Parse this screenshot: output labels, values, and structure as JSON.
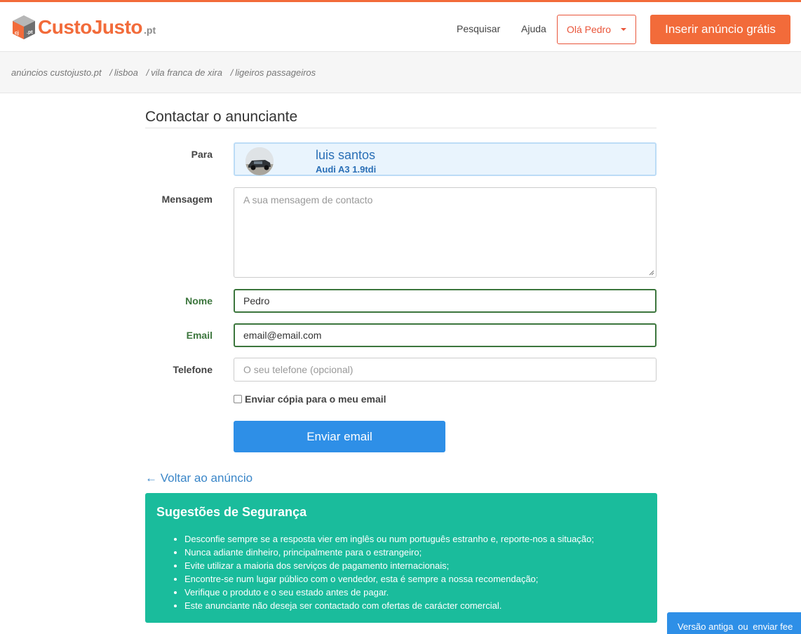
{
  "header": {
    "logo_text": "CustoJusto",
    "logo_tld": ".pt",
    "nav": [
      "Pesquisar",
      "Ajuda"
    ],
    "user_menu_label": "Olá Pedro",
    "cta_label": "Inserir anúncio grátis",
    "accent_color": "#f26b3a"
  },
  "breadcrumb": [
    "anúncios custojusto.pt",
    "lisboa",
    "vila franca de xira",
    "ligeiros passageiros"
  ],
  "page_title": "Contactar o anunciante",
  "form": {
    "to_label": "Para",
    "recipient_name": "luis santos",
    "recipient_ad": "Audi A3 1.9tdi",
    "message_label": "Mensagem",
    "message_placeholder": "A sua mensagem de contacto",
    "message_value": "",
    "name_label": "Nome",
    "name_value": "Pedro",
    "email_label": "Email",
    "email_value": "email@email.com",
    "phone_label": "Telefone",
    "phone_placeholder": "O seu telefone (opcional)",
    "phone_value": "",
    "copy_label": "Enviar cópia para o meu email",
    "copy_checked": false,
    "submit_label": "Enviar email",
    "valid_color": "#3c763d",
    "submit_color": "#2e8fe7"
  },
  "back_link": "← Voltar ao anúncio",
  "safety": {
    "title": "Sugestões de Segurança",
    "items": [
      "Desconfie sempre se a resposta vier em inglês ou num português estranho e, reporte-nos a situação;",
      "Nunca adiante dinheiro, principalmente para o estrangeiro;",
      "Evite utilizar a maioria dos serviços de pagamento internacionais;",
      "Encontre-se num lugar público com o vendedor, esta é sempre a nossa recomendação;",
      "Verifique o produto e o seu estado antes de pagar.",
      "Este anunciante não deseja ser contactado com ofertas de carácter comercial."
    ],
    "bg_color": "#1abc9c"
  },
  "feedback": {
    "old_version": "Versão antiga",
    "separator": "ou",
    "send_feedback": "enviar fee"
  }
}
